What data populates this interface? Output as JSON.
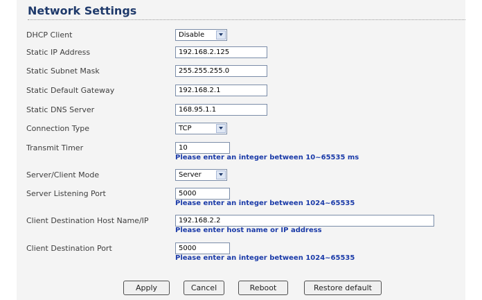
{
  "page": {
    "title": "Network Settings"
  },
  "fields": {
    "dhcp_client": {
      "label": "DHCP Client",
      "value": "Disable"
    },
    "static_ip": {
      "label": "Static IP Address",
      "value": "192.168.2.125"
    },
    "subnet_mask": {
      "label": "Static Subnet Mask",
      "value": "255.255.255.0"
    },
    "gateway": {
      "label": "Static Default Gateway",
      "value": "192.168.2.1"
    },
    "dns_server": {
      "label": "Static DNS Server",
      "value": "168.95.1.1"
    },
    "connection_type": {
      "label": "Connection Type",
      "value": "TCP"
    },
    "transmit_timer": {
      "label": "Transmit Timer",
      "value": "10",
      "hint": "Please enter an integer between 10~65535 ms"
    },
    "server_client_mode": {
      "label": "Server/Client Mode",
      "value": "Server"
    },
    "server_port": {
      "label": "Server Listening Port",
      "value": "5000",
      "hint": "Please enter an integer between 1024~65535"
    },
    "client_host": {
      "label": "Client Destination Host Name/IP",
      "value": "192.168.2.2",
      "hint": "Please enter host name or IP address"
    },
    "client_port": {
      "label": "Client Destination Port",
      "value": "5000",
      "hint": "Please enter an integer between 1024~65535"
    }
  },
  "buttons": {
    "apply": "Apply",
    "cancel": "Cancel",
    "reboot": "Reboot",
    "restore": "Restore default"
  }
}
